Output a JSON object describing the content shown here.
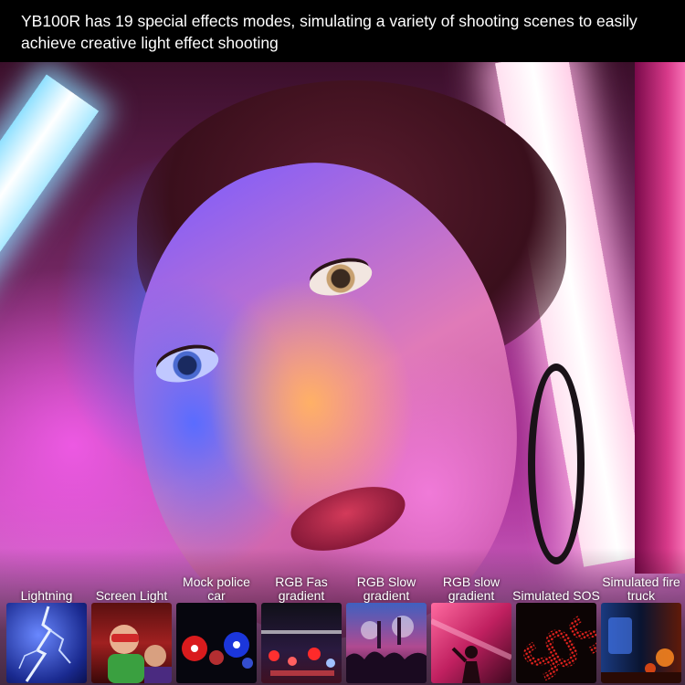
{
  "header": {
    "text": "YB100R has 19 special effects modes, simulating a variety of shooting scenes to easily achieve creative light effect shooting"
  },
  "modes": [
    {
      "label": "Lightning",
      "thumb_icon": "lightning-bolt-icon"
    },
    {
      "label": "Screen Light",
      "thumb_icon": "cinema-audience-icon"
    },
    {
      "label": "Mock police car",
      "thumb_icon": "police-lights-icon"
    },
    {
      "label": "RGB Fas gradient",
      "thumb_icon": "traffic-lights-icon"
    },
    {
      "label": "RGB Slow gradient",
      "thumb_icon": "concert-crowd-icon"
    },
    {
      "label": "RGB slow gradient",
      "thumb_icon": "dancer-silhouette-icon"
    },
    {
      "label": "Simulated SOS",
      "thumb_icon": "sos-led-icon"
    },
    {
      "label": "Simulated fire truck",
      "thumb_icon": "fire-truck-lights-icon"
    }
  ],
  "colors": {
    "header_bg": "#000000",
    "header_text": "#ffffff",
    "sos_red": "#e8231e",
    "light_tube": "#ffffff"
  }
}
